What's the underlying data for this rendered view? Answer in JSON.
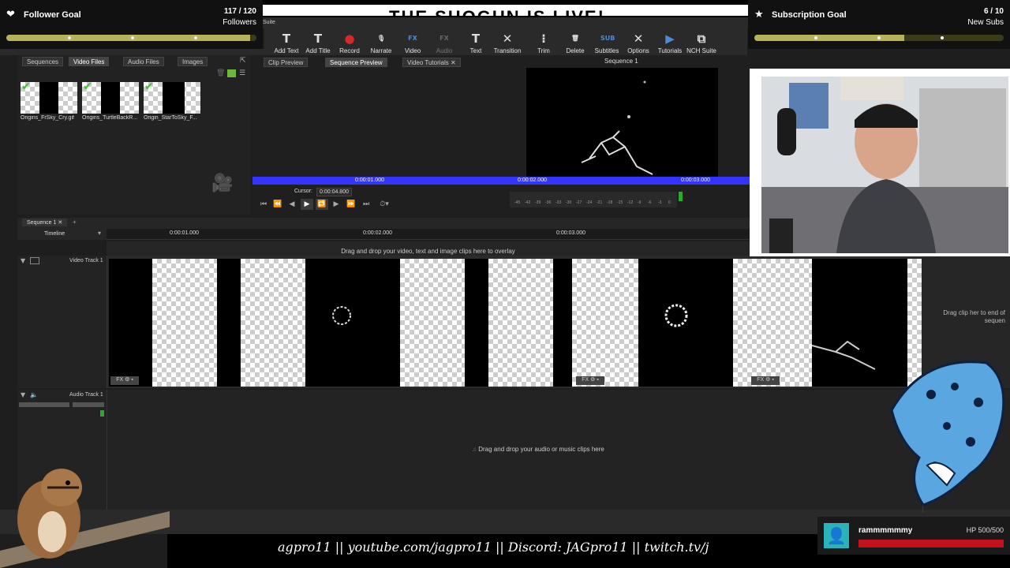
{
  "stream": {
    "banner_text": "THE SHOGUN IS LIVE!",
    "follower_goal": {
      "title": "Follower Goal",
      "count": "117 / 120",
      "unit": "Followers",
      "fraction": 0.975
    },
    "subscription_goal": {
      "title": "Subscription Goal",
      "count": "6 / 10",
      "unit": "New Subs",
      "fraction": 0.6
    },
    "ticker": "agpro11   ||   youtube.com/jagpro11   ||   Discord: JAGpro11   ||   twitch.tv/j",
    "chat_user": "rammmmmmy",
    "hp": "HP 500/500",
    "hp_fraction": 1.0
  },
  "toolbar": {
    "items": [
      {
        "label": "Add Text",
        "icon": "text-icon",
        "glyph": "T"
      },
      {
        "label": "Add Title",
        "icon": "title-icon",
        "glyph": "T"
      },
      {
        "label": "Record",
        "icon": "record-icon",
        "glyph": "●"
      },
      {
        "label": "Narrate",
        "icon": "microphone-icon",
        "glyph": "🎙"
      },
      {
        "label": "Video Effects",
        "icon": "fx-icon",
        "glyph": "FX"
      },
      {
        "label": "Audio Effects",
        "icon": "audio-fx-icon",
        "glyph": "FX"
      },
      {
        "label": "Text Effects",
        "icon": "text-effects-icon",
        "glyph": "T"
      },
      {
        "label": "Transition",
        "icon": "transition-icon",
        "glyph": "✕"
      },
      {
        "label": "Trim",
        "icon": "trim-icon",
        "glyph": "⁝"
      },
      {
        "label": "Delete",
        "icon": "trash-icon",
        "glyph": "🗑"
      },
      {
        "label": "Subtitles",
        "icon": "subtitles-icon",
        "glyph": "SUB"
      },
      {
        "label": "Options",
        "icon": "wrench-icon",
        "glyph": "✕"
      },
      {
        "label": "Tutorials",
        "icon": "tutorials-icon",
        "glyph": "▶"
      },
      {
        "label": "NCH Suite",
        "icon": "suite-icon",
        "glyph": "⧉"
      }
    ],
    "suite_label": "Suite"
  },
  "bin": {
    "tabs": [
      "Sequences",
      "Video Files",
      "Audio Files",
      "Images"
    ],
    "files": [
      "Origins_FrSky_Cry.gif",
      "Origins_TurtleBackR...",
      "Origin_StarToSky_F..."
    ]
  },
  "preview": {
    "tabs": [
      "Clip Preview",
      "Sequence Preview",
      "Video Tutorials"
    ],
    "sequence_title": "Sequence 1",
    "ruler": [
      "0:00:01.000",
      "0:00:02.000",
      "0:00:03.000"
    ],
    "cursor_label": "Cursor:",
    "cursor_value": "0:00:04.800",
    "meter_scale": [
      "-45",
      "-42",
      "-39",
      "-36",
      "-33",
      "-30",
      "-27",
      "-24",
      "-21",
      "-18",
      "-15",
      "-12",
      "-9",
      "-6",
      "-3",
      "0"
    ]
  },
  "timeline": {
    "sequence_tab": "Sequence 1",
    "timeline_label": "Timeline",
    "ruler": [
      "0:00:01.000",
      "0:00:02.000",
      "0:00:03.000"
    ],
    "overlay_hint": "Drag and drop your video, text and image clips here to overlay",
    "video_track": "Video Track 1",
    "audio_track": "Audio Track 1",
    "audio_hint": "Drag and drop your audio or music clips here",
    "end_hint": "Drag clip her to end of sequen"
  }
}
